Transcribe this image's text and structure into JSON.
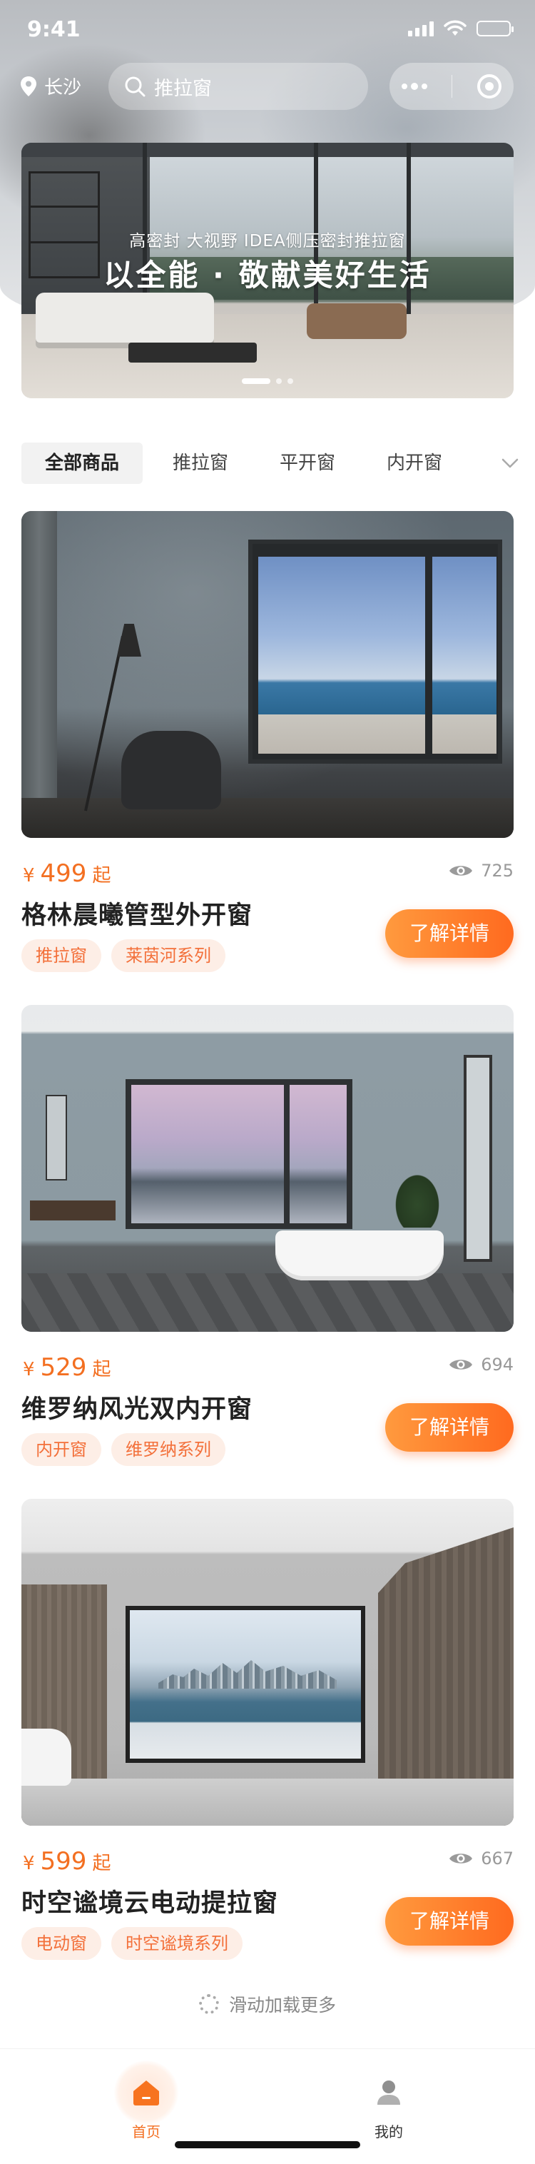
{
  "status_bar": {
    "time": "9:41"
  },
  "header": {
    "city": "长沙",
    "search_text": "推拉窗",
    "icons": [
      "location-pin-icon",
      "search-icon",
      "more-dots-icon",
      "target-icon"
    ]
  },
  "banner": {
    "subtitle": "高密封 大视野 IDEA侧压密封推拉窗",
    "title": "以全能 · 敬献美好生活",
    "slide_count": 3,
    "active_slide": 0
  },
  "tabs": {
    "items": [
      "全部商品",
      "推拉窗",
      "平开窗",
      "内开窗"
    ],
    "active_index": 0,
    "more_icon": "chevron-down-icon"
  },
  "products": [
    {
      "price_symbol": "¥",
      "price": "499",
      "price_suffix": "起",
      "views": "725",
      "name": "格林晨曦管型外开窗",
      "tags": [
        "推拉窗",
        "莱茵河系列"
      ],
      "button": "了解详情"
    },
    {
      "price_symbol": "¥",
      "price": "529",
      "price_suffix": "起",
      "views": "694",
      "name": "维罗纳风光双内开窗",
      "tags": [
        "内开窗",
        "维罗纳系列"
      ],
      "button": "了解详情"
    },
    {
      "price_symbol": "¥",
      "price": "599",
      "price_suffix": "起",
      "views": "667",
      "name": "时空谧境云电动提拉窗",
      "tags": [
        "电动窗",
        "时空谧境系列"
      ],
      "button": "了解详情"
    }
  ],
  "loading": {
    "text": "滑动加载更多"
  },
  "tabbar": {
    "items": [
      {
        "label": "首页",
        "icon": "home-icon",
        "active": true
      },
      {
        "label": "我的",
        "icon": "user-icon",
        "active": false
      }
    ]
  },
  "colors": {
    "accent": "#f36f21",
    "tag_bg": "#fdeee6",
    "button_start": "#ff9a3e",
    "button_end": "#ff6a1f"
  }
}
